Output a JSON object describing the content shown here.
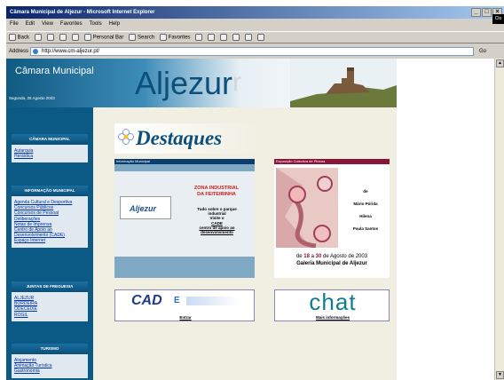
{
  "window": {
    "title": "Câmara Municipal de Aljezur - Microsoft Internet Explorer",
    "buttons": [
      "_",
      "□",
      "×"
    ],
    "tooltip_close": "Clo"
  },
  "menu": [
    "File",
    "Edit",
    "View",
    "Favorites",
    "Tools",
    "Help"
  ],
  "toolbar": {
    "back": "Back",
    "personal_bar": "Personal Bar",
    "search": "Search",
    "favorites": "Favorites"
  },
  "address": {
    "label": "Address",
    "url": "http://www.cm-aljezur.pt/",
    "go": "Go"
  },
  "header": {
    "municipality": "Câmara Municipal",
    "date": "Segunda, 25 Agosto 2003",
    "brand": "Aljezur",
    "brand_ghost": "r"
  },
  "sidebar": {
    "sections": [
      {
        "title": "CÂMARA MUNICIPAL",
        "items": [
          "Autarquia",
          "Heráldica"
        ]
      },
      {
        "title": "INFORMAÇÃO MUNICIPAL",
        "items": [
          "Agenda Cultural e Desportiva",
          "Concursos Públicos",
          "Concursos de Pessoal",
          "Deliberações",
          "Notas de Imprensa",
          "Centro de Apoio ao Desenvolvimento (CADE)",
          "Espaço Internet"
        ]
      },
      {
        "title": "JUNTAS DE FREGUESIA",
        "items": [
          "ALJEZUR",
          "BORDEIRA",
          "ODECEIXE",
          "ROGIL"
        ]
      },
      {
        "title": "TURISMO",
        "items": [
          "Alojamento",
          "Animação Turística",
          "Gastronomia"
        ]
      }
    ]
  },
  "content": {
    "destaques_title": "Destaques",
    "info_card": {
      "header": "Informação Municipal",
      "logo": "Aljezur",
      "zona_line1": "ZONA INDUSTRIAL",
      "zona_line2": "DA FEITEIRINHA",
      "body_line1": "Tudo sobre o parque",
      "body_line2": "industrial",
      "body_line3": "Visite o",
      "body_line4": "CADE",
      "body_line5": "centro de apoio ao",
      "body_line6": "desenvolvimento"
    },
    "expo_card": {
      "header": "Exposição Colectiva de Pintura",
      "de": "de",
      "artist1": "Mário Pórida",
      "artist2": "Hilena",
      "artist3": "Paula Santos",
      "dates_prefix": "de",
      "day1": "18",
      "dates_mid": "a",
      "day2": "30",
      "dates_suffix": "de Agosto de 2003",
      "gallery": "Galeria Municipal de Aljezur"
    },
    "cad_card": {
      "logo": "CAD",
      "logo_e": "E",
      "link": "Entrar"
    },
    "chat_card": {
      "logo": "chat",
      "link": "Mais informações"
    }
  }
}
